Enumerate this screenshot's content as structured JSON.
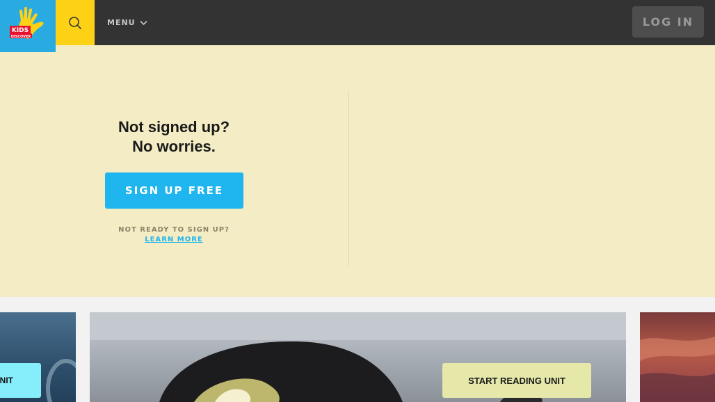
{
  "header": {
    "logo_text": "KIDS DISCOVER",
    "menu_label": "MENU",
    "login_label": "LOG IN",
    "colors": {
      "bar": "#333333",
      "logo_bg": "#29abe2",
      "search_bg": "#fcd116"
    },
    "icons": {
      "search": "search-icon",
      "menu_chevron": "chevron-down-icon"
    }
  },
  "signup": {
    "headline_line1": "Not signed up?",
    "headline_line2": "No worries.",
    "button_label": "SIGN UP FREE",
    "not_ready_text": "NOT READY TO SIGN UP?",
    "learn_more_label": "LEARN MORE",
    "colors": {
      "band_bg": "#f3ecc4",
      "button": "#1fb5ee"
    }
  },
  "carousel": {
    "left_cta_label": "UNIT",
    "main_cta_label": "START READING UNIT"
  }
}
